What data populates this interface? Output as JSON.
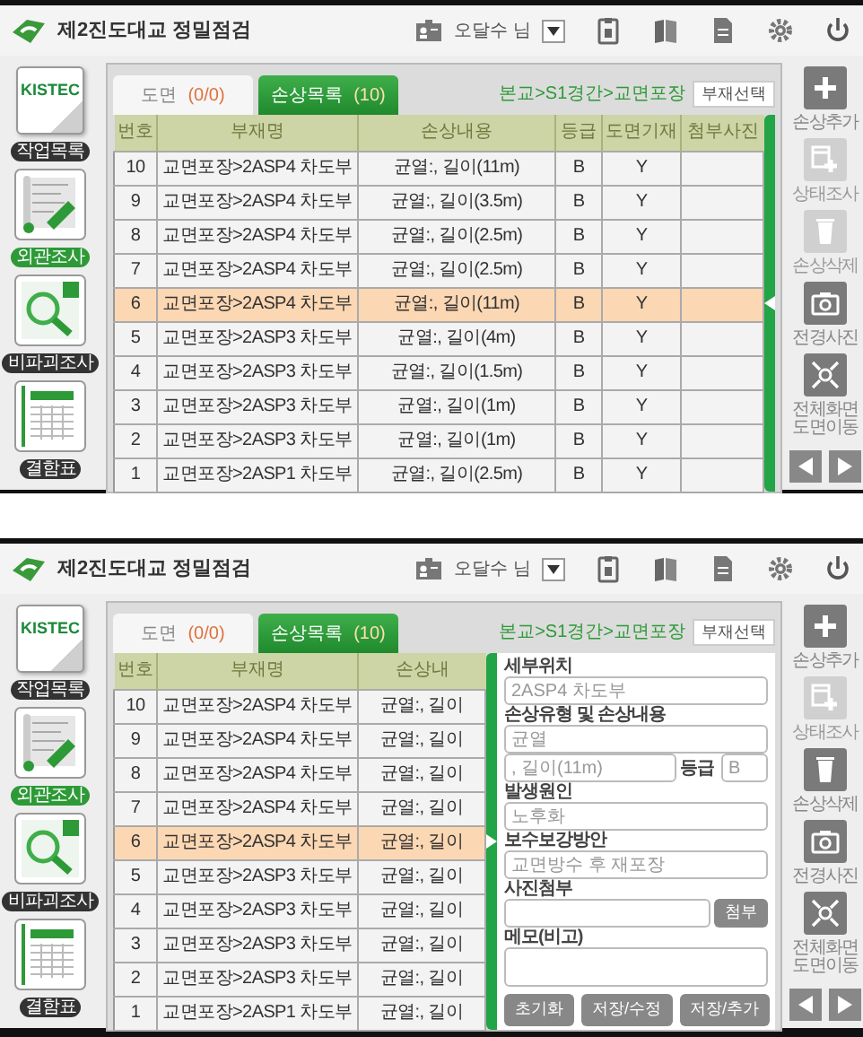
{
  "screens": [
    {
      "app": {
        "title": "제2진도대교 정밀점검",
        "user": "오달수 님"
      },
      "nav": [
        {
          "kind": "logo",
          "logo_text": "KISTEC",
          "label": "작업목록",
          "selected": false
        },
        {
          "kind": "survey",
          "label": "외관조사",
          "selected": true
        },
        {
          "kind": "inspection",
          "label": "비파괴조사",
          "selected": false
        },
        {
          "kind": "sheet",
          "label": "결함표",
          "selected": false
        }
      ],
      "tabs": [
        {
          "label": "도면",
          "count": "(0/0)",
          "selected": false
        },
        {
          "label": "손상목록",
          "count": "(10)",
          "selected": true
        }
      ],
      "breadcrumb": "본교>S1경간>교면포장",
      "select_button": "부재선택",
      "table": {
        "columns": [
          "번호",
          "부재명",
          "손상내용",
          "등급",
          "도면기재",
          "첨부사진"
        ],
        "rows": [
          {
            "cells": [
              "10",
              "교면포장>2ASP4 차도부",
              "균열:, 길이(11m)",
              "B",
              "Y",
              ""
            ],
            "selected": false
          },
          {
            "cells": [
              "9",
              "교면포장>2ASP4 차도부",
              "균열:, 길이(3.5m)",
              "B",
              "Y",
              ""
            ],
            "selected": false
          },
          {
            "cells": [
              "8",
              "교면포장>2ASP4 차도부",
              "균열:, 길이(2.5m)",
              "B",
              "Y",
              ""
            ],
            "selected": false
          },
          {
            "cells": [
              "7",
              "교면포장>2ASP4 차도부",
              "균열:, 길이(2.5m)",
              "B",
              "Y",
              ""
            ],
            "selected": false
          },
          {
            "cells": [
              "6",
              "교면포장>2ASP4 차도부",
              "균열:, 길이(11m)",
              "B",
              "Y",
              ""
            ],
            "selected": true
          },
          {
            "cells": [
              "5",
              "교면포장>2ASP3 차도부",
              "균열:, 길이(4m)",
              "B",
              "Y",
              ""
            ],
            "selected": false
          },
          {
            "cells": [
              "4",
              "교면포장>2ASP3 차도부",
              "균열:, 길이(1.5m)",
              "B",
              "Y",
              ""
            ],
            "selected": false
          },
          {
            "cells": [
              "3",
              "교면포장>2ASP3 차도부",
              "균열:, 길이(1m)",
              "B",
              "Y",
              ""
            ],
            "selected": false
          },
          {
            "cells": [
              "2",
              "교면포장>2ASP3 차도부",
              "균열:, 길이(1m)",
              "B",
              "Y",
              ""
            ],
            "selected": false
          },
          {
            "cells": [
              "1",
              "교면포장>2ASP1 차도부",
              "균열:, 길이(2.5m)",
              "B",
              "Y",
              ""
            ],
            "selected": false
          }
        ]
      },
      "panel": {
        "expanded": false
      },
      "toolbar": [
        {
          "kind": "add",
          "label": "손상추가",
          "disabled": false
        },
        {
          "kind": "survey",
          "label": "상태조사",
          "disabled": true
        },
        {
          "kind": "delete",
          "label": "손상삭제",
          "disabled": true
        },
        {
          "kind": "photo",
          "label": "전경사진",
          "disabled": false
        },
        {
          "kind": "fullscreen",
          "label": "전체화면 도면이동",
          "disabled": false
        }
      ]
    },
    {
      "app": {
        "title": "제2진도대교 정밀점검",
        "user": "오달수 님"
      },
      "nav": [
        {
          "kind": "logo",
          "logo_text": "KISTEC",
          "label": "작업목록",
          "selected": false
        },
        {
          "kind": "survey",
          "label": "외관조사",
          "selected": true
        },
        {
          "kind": "inspection",
          "label": "비파괴조사",
          "selected": false
        },
        {
          "kind": "sheet",
          "label": "결함표",
          "selected": false
        }
      ],
      "tabs": [
        {
          "label": "도면",
          "count": "(0/0)",
          "selected": false
        },
        {
          "label": "손상목록",
          "count": "(10)",
          "selected": true
        }
      ],
      "breadcrumb": "본교>S1경간>교면포장",
      "select_button": "부재선택",
      "table": {
        "columns": [
          "번호",
          "부재명",
          "손상내"
        ],
        "rows": [
          {
            "cells": [
              "10",
              "교면포장>2ASP4 차도부",
              "균열:, 길이"
            ],
            "selected": false
          },
          {
            "cells": [
              "9",
              "교면포장>2ASP4 차도부",
              "균열:, 길이"
            ],
            "selected": false
          },
          {
            "cells": [
              "8",
              "교면포장>2ASP4 차도부",
              "균열:, 길이"
            ],
            "selected": false
          },
          {
            "cells": [
              "7",
              "교면포장>2ASP4 차도부",
              "균열:, 길이"
            ],
            "selected": false
          },
          {
            "cells": [
              "6",
              "교면포장>2ASP4 차도부",
              "균열:, 길이"
            ],
            "selected": true
          },
          {
            "cells": [
              "5",
              "교면포장>2ASP3 차도부",
              "균열:, 길이"
            ],
            "selected": false
          },
          {
            "cells": [
              "4",
              "교면포장>2ASP3 차도부",
              "균열:, 길이"
            ],
            "selected": false
          },
          {
            "cells": [
              "3",
              "교면포장>2ASP3 차도부",
              "균열:, 길이"
            ],
            "selected": false
          },
          {
            "cells": [
              "2",
              "교면포장>2ASP3 차도부",
              "균열:, 길이"
            ],
            "selected": false
          },
          {
            "cells": [
              "1",
              "교면포장>2ASP1 차도부",
              "균열:, 길이"
            ],
            "selected": false
          }
        ]
      },
      "panel": {
        "expanded": true,
        "form": {
          "location": {
            "label": "세부위치",
            "value": "2ASP4 차도부"
          },
          "damage": {
            "label": "손상유형 및 손상내용",
            "type_value": "균열",
            "detail_value": ", 길이(11m)",
            "grade_label": "등급",
            "grade_value": "B"
          },
          "cause": {
            "label": "발생원인",
            "value": "노후화"
          },
          "repair": {
            "label": "보수보강방안",
            "value": "교면방수 후 재포장"
          },
          "photo": {
            "label": "사진첨부",
            "button": "첨부"
          },
          "memo": {
            "label": "메모(비고)"
          },
          "buttons": [
            "초기화",
            "저장/수정",
            "저장/추가"
          ]
        }
      },
      "toolbar": [
        {
          "kind": "add",
          "label": "손상추가",
          "disabled": false
        },
        {
          "kind": "survey",
          "label": "상태조사",
          "disabled": true
        },
        {
          "kind": "delete",
          "label": "손상삭제",
          "disabled": false
        },
        {
          "kind": "photo",
          "label": "전경사진",
          "disabled": false
        },
        {
          "kind": "fullscreen",
          "label": "전체화면 도면이동",
          "disabled": false
        }
      ]
    }
  ]
}
